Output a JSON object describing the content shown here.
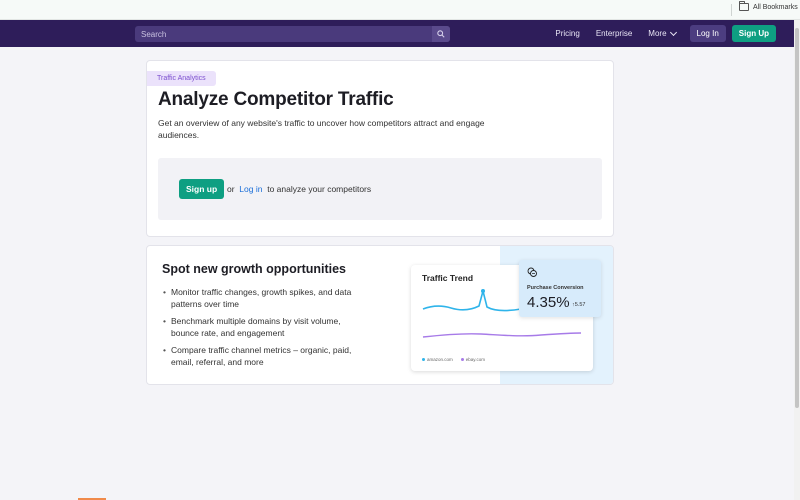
{
  "bookmarks_bar": {
    "all_bookmarks": "All Bookmarks",
    "folder_icon": "folder-icon"
  },
  "header": {
    "search_placeholder": "Search",
    "search_icon": "search-icon",
    "nav": {
      "pricing": "Pricing",
      "enterprise": "Enterprise",
      "more": "More",
      "login": "Log In",
      "signup": "Sign Up"
    }
  },
  "hero": {
    "tag": "Traffic Analytics",
    "title": "Analyze Competitor Traffic",
    "description": "Get an overview of any website's traffic to uncover how competitors attract and engage audiences.",
    "cta": {
      "signup": "Sign up",
      "or": "or",
      "login": "Log in",
      "suffix": "to analyze your competitors"
    }
  },
  "growth": {
    "title": "Spot new growth opportunities",
    "bullets": [
      "Monitor traffic changes, growth spikes, and data patterns over time",
      "Benchmark multiple domains by visit volume, bounce rate, and engagement",
      "Compare traffic channel metrics – organic, paid, email, referral, and more"
    ]
  },
  "illustration": {
    "trend_title": "Traffic Trend",
    "legend": [
      "amazon.com",
      "ebay.com"
    ],
    "conversion_label": "Purchase Conversion",
    "conversion_value": "4.35%",
    "conversion_delta": "↑5.57",
    "colors": {
      "series1": "#2fb4ea",
      "series2": "#a77be8",
      "conversion_bg": "#d7ebfb"
    }
  },
  "colors": {
    "header_bg": "#2e1d5a",
    "accent_green": "#0e9f82",
    "link_blue": "#1a6ed8",
    "tag_purple": "#7b4ecf"
  }
}
